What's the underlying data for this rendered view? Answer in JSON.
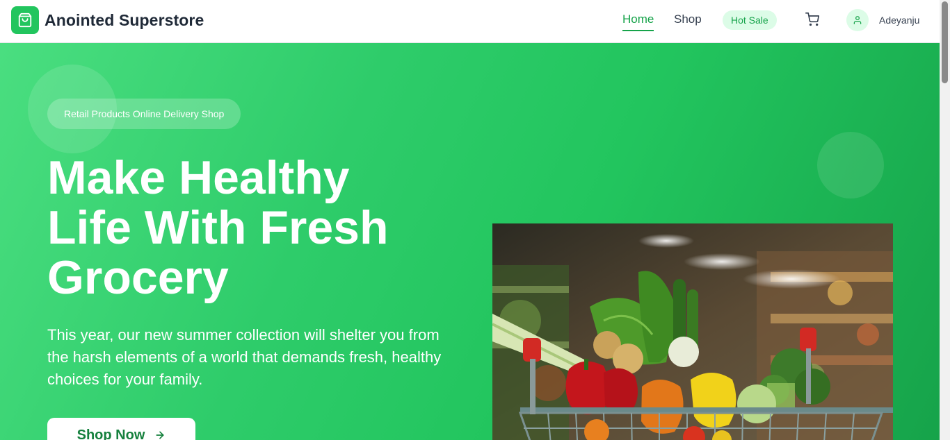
{
  "brand": {
    "name": "Anointed Superstore",
    "accent": "#22c55e"
  },
  "nav": {
    "home": "Home",
    "shop": "Shop",
    "hot_sale": "Hot Sale",
    "user_name": "Adeyanju"
  },
  "hero": {
    "tagline": "Retail Products Online Delivery Shop",
    "title_line1": "Make Healthy",
    "title_line2": "Life With Fresh",
    "title_line3": "Grocery",
    "description": "This year, our new summer collection will shelter you from the harsh elements of a world that demands fresh, healthy choices for your family.",
    "cta": "Shop Now"
  },
  "icons": {
    "logo": "shopping-bag-icon",
    "cart": "cart-icon",
    "user": "user-icon",
    "arrow": "arrow-right-icon"
  },
  "colors": {
    "green_dark": "#16a34a",
    "green_light": "#4ade80",
    "badge_bg": "#dcfce7"
  }
}
